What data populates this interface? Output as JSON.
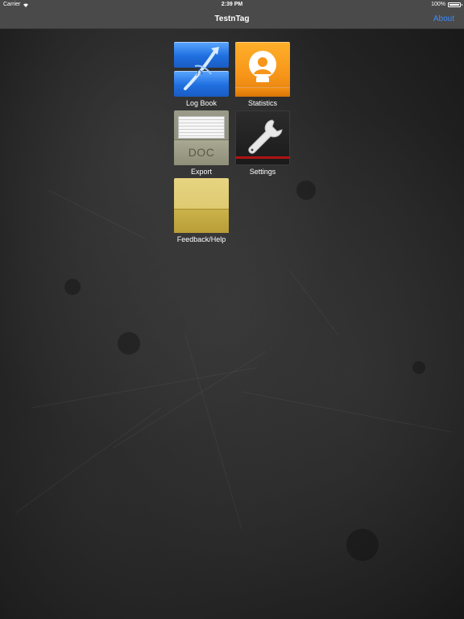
{
  "status_bar": {
    "carrier": "Carrier",
    "time": "2:39 PM",
    "battery": "100%",
    "battery_level": 1.0,
    "icons": [
      "wifi-icon",
      "battery-icon"
    ]
  },
  "nav_bar": {
    "title": "TestnTag",
    "about_label": "About",
    "about_color": "#3b8cff"
  },
  "tiles": [
    {
      "label": "Log Book",
      "icon": "logbook-icon",
      "color": "#1f6fe0"
    },
    {
      "label": "Statistics",
      "icon": "statistics-icon",
      "color": "#f7961a"
    },
    {
      "label": "Export",
      "icon": "export-doc-icon",
      "doc_text": "DOC",
      "color": "#8f8e78"
    },
    {
      "label": "Settings",
      "icon": "wrench-icon",
      "color": "#1a1a1a"
    },
    {
      "label": "Feedback/Help",
      "icon": "folder-icon",
      "color": "#d8c262"
    }
  ]
}
